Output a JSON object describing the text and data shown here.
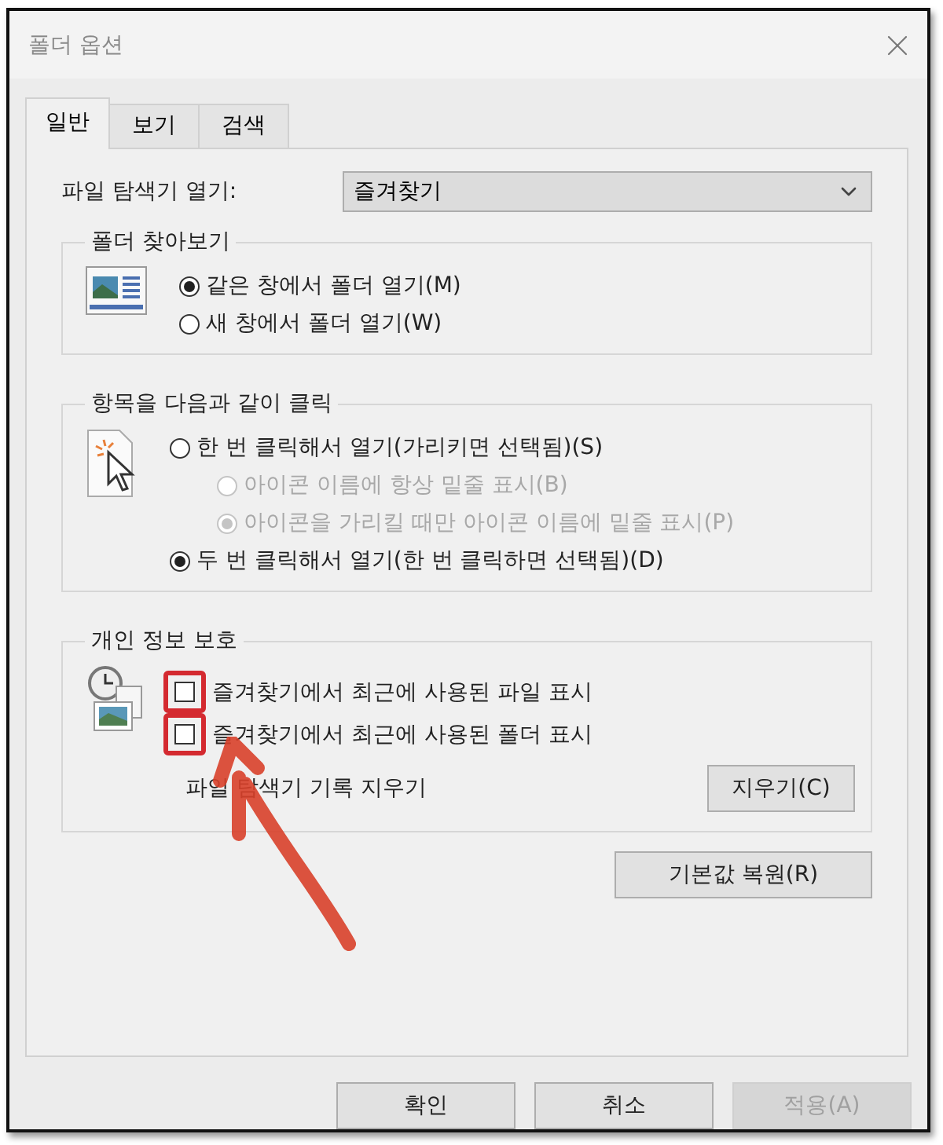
{
  "window": {
    "title": "폴더 옵션"
  },
  "tabs": [
    {
      "label": "일반",
      "selected": true
    },
    {
      "label": "보기",
      "selected": false
    },
    {
      "label": "검색",
      "selected": false
    }
  ],
  "open_explorer": {
    "label": "파일 탐색기 열기:",
    "value": "즐겨찾기"
  },
  "groups": [
    {
      "title": "폴더 찾아보기",
      "kind": "browse",
      "options": [
        {
          "label": "같은 창에서 폴더 열기(M)",
          "selected": true,
          "disabled": false
        },
        {
          "label": "새 창에서 폴더 열기(W)",
          "selected": false,
          "disabled": false
        }
      ]
    },
    {
      "title": "항목을 다음과 같이 클릭",
      "kind": "click",
      "options": [
        {
          "label": "한 번 클릭해서 열기(가리키면 선택됨)(S)",
          "selected": false,
          "disabled": false,
          "children": [
            {
              "label": "아이콘 이름에 항상 밑줄 표시(B)",
              "selected": false,
              "disabled": true
            },
            {
              "label": "아이콘을 가리킬 때만 아이콘 이름에 밑줄 표시(P)",
              "selected": true,
              "disabled": true
            }
          ]
        },
        {
          "label": "두 번 클릭해서 열기(한 번 클릭하면 선택됨)(D)",
          "selected": true,
          "disabled": false
        }
      ]
    }
  ],
  "privacy": {
    "title": "개인 정보 보호",
    "checkboxes": [
      {
        "label": "즐겨찾기에서 최근에 사용된 파일 표시",
        "checked": false,
        "highlighted": true
      },
      {
        "label": "즐겨찾기에서 최근에 사용된 폴더 표시",
        "checked": false,
        "highlighted": true
      }
    ],
    "clear_label": "파일 탐색기 기록 지우기",
    "clear_button": "지우기(C)"
  },
  "restore_button": "기본값 복원(R)",
  "buttons": [
    {
      "label": "확인",
      "disabled": false
    },
    {
      "label": "취소",
      "disabled": false
    },
    {
      "label": "적용(A)",
      "disabled": true
    }
  ]
}
